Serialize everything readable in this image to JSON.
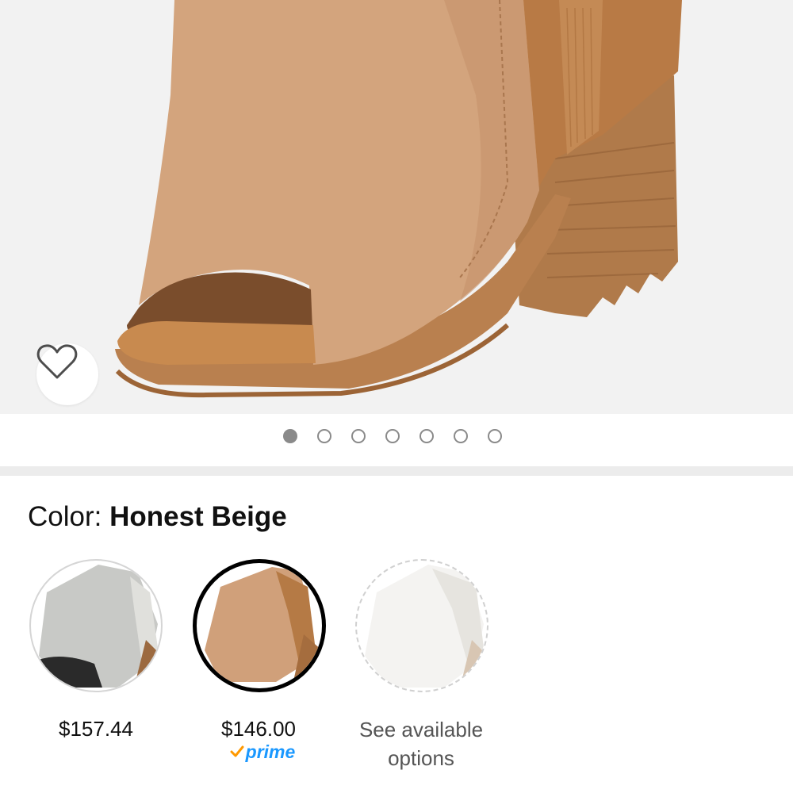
{
  "product": {
    "main_image_alt": "Honest Beige peep-toe block-heel bootie",
    "image_count": 7,
    "active_image_index": 0
  },
  "color": {
    "label": "Color: ",
    "selected_value": "Honest Beige"
  },
  "swatches": [
    {
      "price": "$157.44",
      "selected": false
    },
    {
      "price": "$146.00",
      "selected": true,
      "badge": "prime"
    },
    {
      "price": null,
      "action_text_line1": "See available",
      "action_text_line2": "options",
      "selected": false
    }
  ],
  "icons": {
    "wishlist": "heart-outline-icon",
    "prime_check": "checkmark-icon"
  },
  "colors": {
    "hero_bg": "#f2f2f2",
    "prime_blue": "#1a98ff",
    "prime_check": "#ff9900",
    "dot_active": "#8a8a8a"
  }
}
